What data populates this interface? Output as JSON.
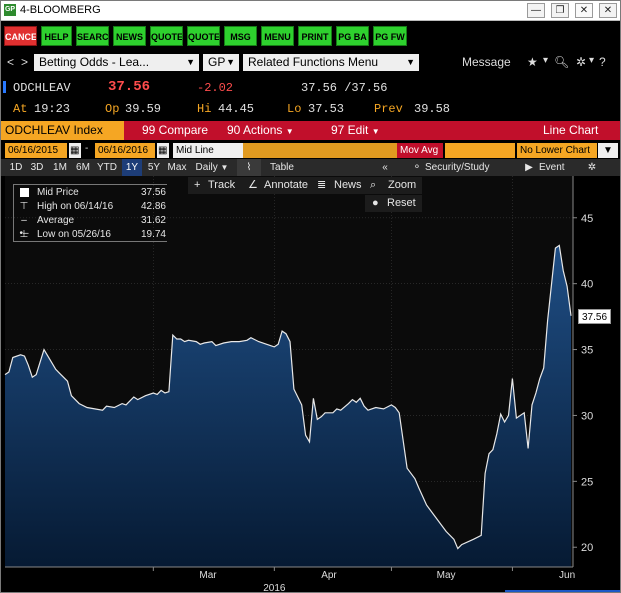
{
  "window": {
    "title": "4-BLOOMBERG",
    "logo": "GP"
  },
  "function_keys": [
    "CANCE",
    "HELP",
    "SEARC",
    "NEWS",
    "QUOTE",
    "QUOTE",
    "MSG",
    "MENU",
    "PRINT",
    "PG BA",
    "PG FW"
  ],
  "nav": {
    "security_box": "Betting Odds - Lea...",
    "function_box": "GP",
    "related_box": "Related Functions Menu",
    "message": "Message"
  },
  "quote": {
    "ticker": "ODCHLEAV",
    "last": "37.56",
    "change": "-2.02",
    "bid_ask": "37.56 /37.56",
    "at_label": "At",
    "at": "19:23",
    "op_label": "Op",
    "op": "39.59",
    "hi_label": "Hi",
    "hi": "44.45",
    "lo_label": "Lo",
    "lo": "37.53",
    "prev_label": "Prev",
    "prev": "39.58"
  },
  "toolbar": {
    "index": "ODCHLEAV Index",
    "compare": "99 Compare",
    "actions": "90 Actions",
    "edit": "97 Edit",
    "chart_type": "Line Chart"
  },
  "dates": {
    "start": "06/16/2015",
    "end": "06/16/2016",
    "field": "Mid Line",
    "mov_avg": "Mov Avg",
    "lower": "No Lower Chart"
  },
  "periods": [
    "1D",
    "3D",
    "1M",
    "6M",
    "YTD",
    "1Y",
    "5Y",
    "Max"
  ],
  "selected_period": "1Y",
  "frequency": "Daily",
  "table_label": "Table",
  "security_study": "Security/Study",
  "event": "Event",
  "tools": {
    "track": "Track",
    "annotate": "Annotate",
    "news": "News",
    "zoom": "Zoom",
    "reset": "Reset"
  },
  "legend": [
    {
      "label": "Mid Price",
      "value": "37.56"
    },
    {
      "label": "High on 06/14/16",
      "value": "42.86"
    },
    {
      "label": "Average",
      "value": "31.62"
    },
    {
      "label": "Low on 05/26/16",
      "value": "19.74"
    }
  ],
  "chart_data": {
    "type": "area",
    "series_name": "Mid Price",
    "last_value": "37.56",
    "ylim": [
      18.5,
      46.5
    ],
    "y_ticks": [
      20,
      25,
      30,
      35,
      40,
      45
    ],
    "xlim": [
      "2016-01-23",
      "2016-06-16"
    ],
    "x_ticks": [
      {
        "date": "2016-03-01",
        "label": "Mar"
      },
      {
        "date": "2016-04-01",
        "label": "Apr"
      },
      {
        "date": "2016-05-01",
        "label": "May"
      },
      {
        "date": "2016-06-01",
        "label": "Jun"
      }
    ],
    "year_label": {
      "date": "2016-04-01",
      "label": "2016"
    },
    "colors": {
      "line": "#e8e8e8",
      "fill_top": "#1f4e85",
      "fill_bottom": "#061a33",
      "grid": "#3a3a3a"
    },
    "points": [
      [
        "2016-01-23",
        33.1
      ],
      [
        "2016-01-24",
        33.3
      ],
      [
        "2016-01-25",
        34.4
      ],
      [
        "2016-01-27",
        34.6
      ],
      [
        "2016-01-28",
        34.5
      ],
      [
        "2016-01-29",
        33.8
      ],
      [
        "2016-01-30",
        32.9
      ],
      [
        "2016-01-31",
        33.1
      ],
      [
        "2016-02-02",
        35.0
      ],
      [
        "2016-02-04",
        34.0
      ],
      [
        "2016-02-05",
        33.5
      ],
      [
        "2016-02-06",
        33.2
      ],
      [
        "2016-02-08",
        32.6
      ],
      [
        "2016-02-09",
        31.5
      ],
      [
        "2016-02-11",
        30.9
      ],
      [
        "2016-02-13",
        30.6
      ],
      [
        "2016-02-15",
        30.5
      ],
      [
        "2016-02-17",
        30.4
      ],
      [
        "2016-02-18",
        30.7
      ],
      [
        "2016-02-20",
        30.6
      ],
      [
        "2016-02-22",
        30.9
      ],
      [
        "2016-02-23",
        30.8
      ],
      [
        "2016-02-25",
        31.4
      ],
      [
        "2016-02-26",
        31.2
      ],
      [
        "2016-02-28",
        31.5
      ],
      [
        "2016-03-01",
        31.7
      ],
      [
        "2016-03-02",
        31.6
      ],
      [
        "2016-03-03",
        31.9
      ],
      [
        "2016-03-04",
        31.7
      ],
      [
        "2016-03-05",
        31.8
      ],
      [
        "2016-03-06",
        36.1
      ],
      [
        "2016-03-07",
        35.8
      ],
      [
        "2016-03-08",
        35.8
      ],
      [
        "2016-03-09",
        35.6
      ],
      [
        "2016-03-10",
        35.7
      ],
      [
        "2016-03-12",
        35.6
      ],
      [
        "2016-03-13",
        35.4
      ],
      [
        "2016-03-14",
        35.5
      ],
      [
        "2016-03-16",
        35.6
      ],
      [
        "2016-03-17",
        35.3
      ],
      [
        "2016-03-19",
        35.5
      ],
      [
        "2016-03-21",
        35.6
      ],
      [
        "2016-03-23",
        35.6
      ],
      [
        "2016-03-25",
        35.7
      ],
      [
        "2016-03-26",
        35.9
      ],
      [
        "2016-03-28",
        35.6
      ],
      [
        "2016-03-31",
        35.3
      ],
      [
        "2016-04-01",
        35.2
      ],
      [
        "2016-04-02",
        35.4
      ],
      [
        "2016-04-03",
        36.4
      ],
      [
        "2016-04-04",
        36.2
      ],
      [
        "2016-04-05",
        35.6
      ],
      [
        "2016-04-06",
        32.0
      ],
      [
        "2016-04-08",
        30.8
      ],
      [
        "2016-04-09",
        28.5
      ],
      [
        "2016-04-10",
        28.0
      ],
      [
        "2016-04-11",
        31.3
      ],
      [
        "2016-04-12",
        29.7
      ],
      [
        "2016-04-13",
        29.9
      ],
      [
        "2016-04-14",
        30.2
      ],
      [
        "2016-04-16",
        30.2
      ],
      [
        "2016-04-17",
        30.5
      ],
      [
        "2016-04-18",
        30.4
      ],
      [
        "2016-04-20",
        30.9
      ],
      [
        "2016-04-21",
        31.2
      ],
      [
        "2016-04-22",
        31.0
      ],
      [
        "2016-04-23",
        31.3
      ],
      [
        "2016-04-24",
        30.7
      ],
      [
        "2016-04-25",
        30.4
      ],
      [
        "2016-04-27",
        30.6
      ],
      [
        "2016-04-29",
        30.5
      ],
      [
        "2016-05-01",
        30.8
      ],
      [
        "2016-05-02",
        30.6
      ],
      [
        "2016-05-03",
        30.2
      ],
      [
        "2016-05-05",
        26.0
      ],
      [
        "2016-05-07",
        25.2
      ],
      [
        "2016-05-08",
        24.5
      ],
      [
        "2016-05-10",
        23.2
      ],
      [
        "2016-05-12",
        22.4
      ],
      [
        "2016-05-15",
        21.2
      ],
      [
        "2016-05-17",
        20.6
      ],
      [
        "2016-05-18",
        19.9
      ],
      [
        "2016-05-19",
        20.2
      ],
      [
        "2016-05-22",
        20.6
      ],
      [
        "2016-05-24",
        20.9
      ],
      [
        "2016-05-25",
        25.6
      ],
      [
        "2016-05-26",
        27.1
      ],
      [
        "2016-05-27",
        27.4
      ],
      [
        "2016-05-28",
        28.6
      ],
      [
        "2016-05-29",
        30.1
      ],
      [
        "2016-05-30",
        29.5
      ],
      [
        "2016-05-31",
        30.0
      ],
      [
        "2016-06-01",
        32.8
      ],
      [
        "2016-06-02",
        29.8
      ],
      [
        "2016-06-04",
        30.2
      ],
      [
        "2016-06-05",
        27.5
      ],
      [
        "2016-06-06",
        30.8
      ],
      [
        "2016-06-07",
        31.7
      ],
      [
        "2016-06-08",
        32.8
      ],
      [
        "2016-06-09",
        33.6
      ],
      [
        "2016-06-10",
        37.2
      ],
      [
        "2016-06-12",
        42.7
      ],
      [
        "2016-06-13",
        42.9
      ],
      [
        "2016-06-14",
        41.0
      ],
      [
        "2016-06-15",
        39.8
      ],
      [
        "2016-06-16",
        37.56
      ]
    ]
  }
}
